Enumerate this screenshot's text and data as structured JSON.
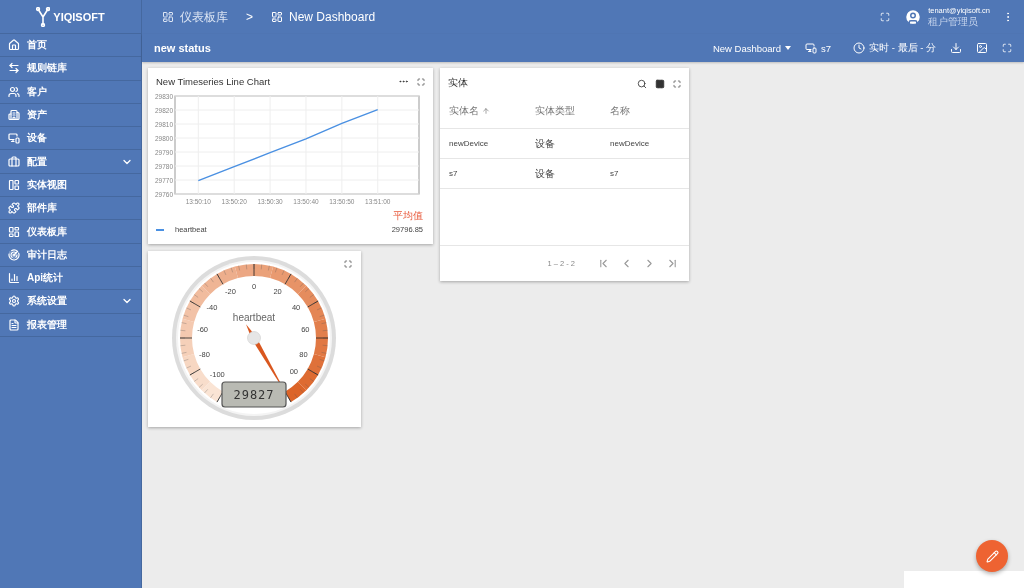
{
  "brand": {
    "name": "YIQISOFT"
  },
  "breadcrumb": [
    {
      "label": "仪表板库"
    },
    {
      "label": ">"
    },
    {
      "label": "New Dashboard"
    }
  ],
  "user": {
    "email": "tenant@yiqisoft.cn",
    "role": "租户管理员"
  },
  "sidebar": {
    "items": [
      {
        "label": "首页",
        "kind": "link"
      },
      {
        "label": "规则链库",
        "kind": "link"
      },
      {
        "label": "客户",
        "kind": "link"
      },
      {
        "label": "资产",
        "kind": "link"
      },
      {
        "label": "设备",
        "kind": "link"
      },
      {
        "label": "配置",
        "kind": "group",
        "expanded": false
      },
      {
        "label": "实体视图",
        "kind": "link"
      },
      {
        "label": "部件库",
        "kind": "link"
      },
      {
        "label": "仪表板库",
        "kind": "link"
      },
      {
        "label": "审计日志",
        "kind": "link"
      },
      {
        "label": "Api统计",
        "kind": "link"
      },
      {
        "label": "系统设置",
        "kind": "group",
        "expanded": false
      },
      {
        "label": "报表管理",
        "kind": "link"
      }
    ]
  },
  "toolbar": {
    "title": "new status",
    "dashboard": "New Dashboard",
    "entity": "s7",
    "timewindow": "实时 - 最后 - 分"
  },
  "line_widget": {
    "title": "New Timeseries Line Chart",
    "legend_header": "平均值",
    "legend": [
      {
        "value": "29796.85"
      }
    ],
    "chart_data": {
      "type": "line",
      "grid": true,
      "categories": [
        "13:50:10",
        "13:50:20",
        "13:50:30",
        "13:50:40",
        "13:50:50",
        "13:51:00"
      ],
      "series": [
        {
          "name": "heartbeat",
          "color": "#4a90e2",
          "values": [
            29769.6,
            29779.6,
            29789.5,
            29799.4,
            29810.5,
            29820.3
          ]
        }
      ],
      "ylim": [
        29760,
        29830
      ],
      "yticks": [
        29760,
        29770,
        29780,
        29790,
        29800,
        29810,
        29820,
        29830
      ]
    }
  },
  "entity_widget": {
    "title": "实体",
    "columns": [
      {
        "label": "实体名",
        "sorted": true
      },
      {
        "label": "实体类型",
        "sorted": false
      },
      {
        "label": "名称",
        "sorted": false
      }
    ],
    "rows": [
      [
        "newDevice",
        "设备",
        "newDevice"
      ],
      [
        "s7",
        "设备",
        "s7"
      ]
    ],
    "range": "1 – 2 - 2"
  },
  "gauge_widget": {
    "title": "heartbeat",
    "value": "29827",
    "tick_labels": [
      "-100",
      "-80",
      "-60",
      "-40",
      "-20",
      "0",
      "20",
      "40",
      "60",
      "80",
      "00"
    ]
  }
}
